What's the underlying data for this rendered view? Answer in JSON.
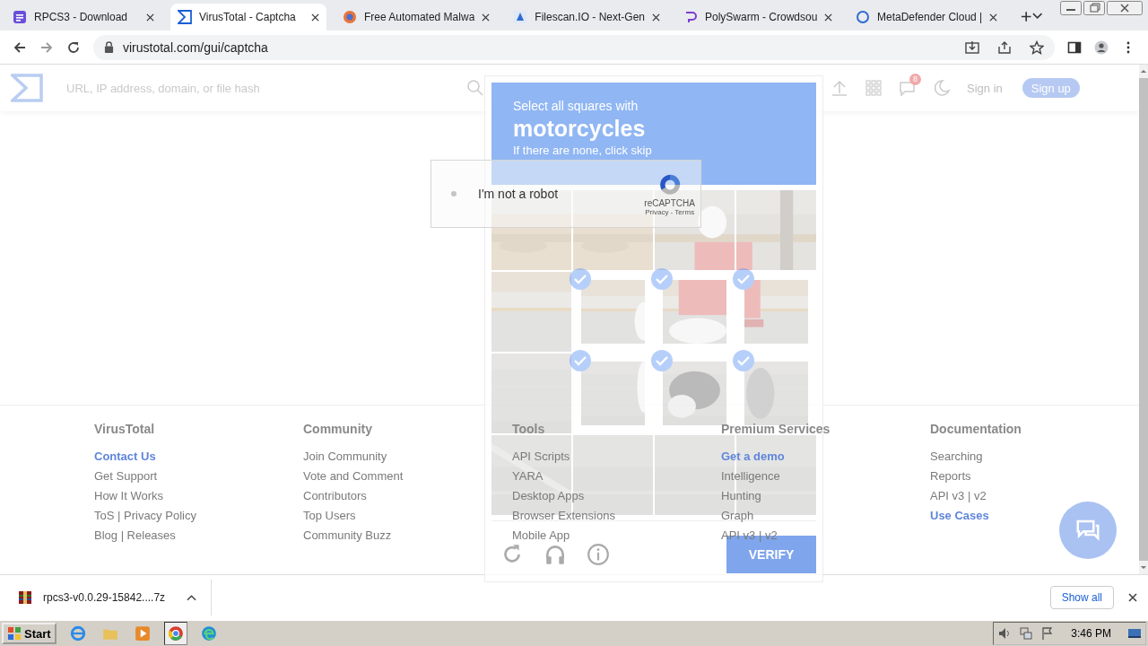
{
  "tabs": [
    {
      "title": "RPCS3 - Download",
      "kind": "rpcs3",
      "selected": false
    },
    {
      "title": "VirusTotal - Captcha",
      "kind": "virustotal",
      "selected": true
    },
    {
      "title": "Free Automated Malwa",
      "kind": "globe",
      "selected": false
    },
    {
      "title": "Filescan.IO - Next-Gen",
      "kind": "filescan",
      "selected": false
    },
    {
      "title": "PolySwarm - Crowdsou",
      "kind": "polyswarm",
      "selected": false
    },
    {
      "title": "MetaDefender Cloud |",
      "kind": "ring",
      "selected": false
    }
  ],
  "address_bar": {
    "url": "virustotal.com/gui/captcha"
  },
  "header": {
    "search": {
      "placeholder": "URL, IP address, domain, or file hash"
    },
    "notification_count": "8",
    "sign_in": "Sign in",
    "sign_up": "Sign up"
  },
  "recaptcha_checkbox": {
    "checked": false,
    "label": "I'm not a robot",
    "brand": "reCAPTCHA",
    "links": "Privacy - Terms"
  },
  "captcha": {
    "instruction": "Select all squares with",
    "target": "motorcycles",
    "hint": "If there are none, click skip",
    "verify": "VERIFY",
    "tiles": [
      {
        "selected": false
      },
      {
        "selected": false
      },
      {
        "selected": false
      },
      {
        "selected": false
      },
      {
        "selected": false
      },
      {
        "selected": true
      },
      {
        "selected": true
      },
      {
        "selected": true
      },
      {
        "selected": false
      },
      {
        "selected": true
      },
      {
        "selected": true
      },
      {
        "selected": true
      },
      {
        "selected": false
      },
      {
        "selected": false
      },
      {
        "selected": false
      },
      {
        "selected": false
      }
    ]
  },
  "footer": {
    "columns": [
      {
        "title": "VirusTotal",
        "links": [
          {
            "text": "Contact Us",
            "highlighted": true
          },
          {
            "text": "Get Support",
            "highlighted": false
          },
          {
            "text": "How It Works",
            "highlighted": false
          },
          {
            "text": "ToS | Privacy Policy",
            "highlighted": false
          },
          {
            "text": "Blog | Releases",
            "highlighted": false
          }
        ]
      },
      {
        "title": "Community",
        "links": [
          {
            "text": "Join Community",
            "highlighted": false
          },
          {
            "text": "Vote and Comment",
            "highlighted": false
          },
          {
            "text": "Contributors",
            "highlighted": false
          },
          {
            "text": "Top Users",
            "highlighted": false
          },
          {
            "text": "Community Buzz",
            "highlighted": false
          }
        ]
      },
      {
        "title": "Tools",
        "links": [
          {
            "text": "API Scripts",
            "highlighted": false
          },
          {
            "text": "YARA",
            "highlighted": false
          },
          {
            "text": "Desktop Apps",
            "highlighted": false
          },
          {
            "text": "Browser Extensions",
            "highlighted": false
          },
          {
            "text": "Mobile App",
            "highlighted": false
          }
        ]
      },
      {
        "title": "Premium Services",
        "links": [
          {
            "text": "Get a demo",
            "highlighted": true
          },
          {
            "text": "Intelligence",
            "highlighted": false
          },
          {
            "text": "Hunting",
            "highlighted": false
          },
          {
            "text": "Graph",
            "highlighted": false
          },
          {
            "text": "API v3 | v2",
            "highlighted": false
          }
        ]
      },
      {
        "title": "Documentation",
        "links": [
          {
            "text": "Searching",
            "highlighted": false
          },
          {
            "text": "Reports",
            "highlighted": false
          },
          {
            "text": "API v3 | v2",
            "highlighted": false
          },
          {
            "text": "Use Cases",
            "highlighted": true
          }
        ]
      }
    ]
  },
  "download_bar": {
    "file": "rpcs3-v0.0.29-15842....7z",
    "show_all": "Show all"
  },
  "taskbar": {
    "start": "Start",
    "clock": "3:46 PM"
  }
}
